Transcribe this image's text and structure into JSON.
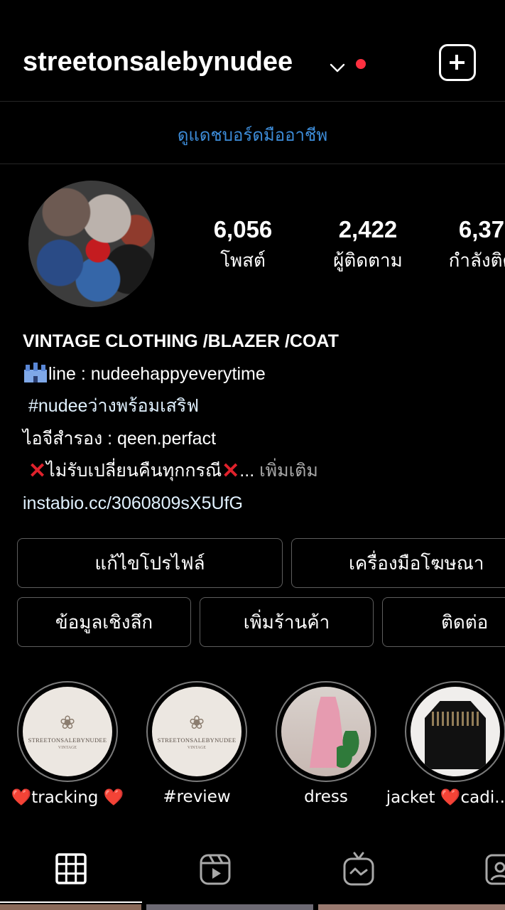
{
  "header": {
    "username": "streetonsalebynudee",
    "icons": {
      "chevron": "chevron-down-icon",
      "notification": "notification-dot",
      "add": "add-square-icon"
    },
    "notification_color": "#ff3040"
  },
  "dashboard": {
    "label": "ดูแดชบอร์ดมืออาชีพ",
    "color": "#3d8cd8"
  },
  "profile": {
    "stats": [
      {
        "value": "6,056",
        "label": "โพสต์"
      },
      {
        "value": "2,422",
        "label": "ผู้ติดตาม"
      },
      {
        "value": "6,37",
        "label": "กำลังติด"
      }
    ]
  },
  "bio": {
    "title": "VINTAGE CLOTHING /BLAZER /COAT",
    "line": "line : nudeehappyeverytime",
    "hashtag": "#nudeeว่างพร้อมเสริฟ",
    "backup": "ไอจีสำรอง : qeen.perfact",
    "policy": "ไม่รับเปลี่ยนคืนทุกกรณี",
    "ellipsis": "...",
    "more": "เพิ่มเติม",
    "link": "instabio.cc/3060809sX5UfG"
  },
  "buttons": {
    "edit_profile": "แก้ไขโปรไฟล์",
    "ad_tools": "เครื่องมือโฆษณา",
    "insights": "ข้อมูลเชิงลึก",
    "add_shop": "เพิ่มร้านค้า",
    "contact": "ติดต่อ"
  },
  "highlights": [
    {
      "label": "❤️tracking ❤️",
      "brand": "STREETONSALEBYNUDEE",
      "sub": "VINTAGE"
    },
    {
      "label": "#review",
      "brand": "STREETONSALEBYNUDEE",
      "sub": "VINTAGE"
    },
    {
      "label": "dress"
    },
    {
      "label": "jacket ❤️cadi..."
    }
  ],
  "tabs": [
    {
      "icon": "grid-icon",
      "active": true
    },
    {
      "icon": "reels-icon",
      "active": false
    },
    {
      "icon": "igtv-icon",
      "active": false
    },
    {
      "icon": "tagged-icon",
      "active": false
    }
  ]
}
